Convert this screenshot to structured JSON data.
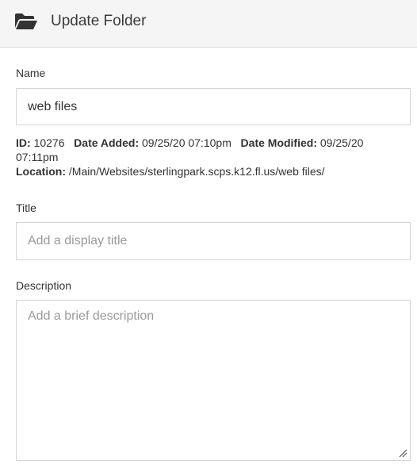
{
  "header": {
    "icon": "folder-open-icon",
    "title": "Update Folder"
  },
  "form": {
    "name": {
      "label": "Name",
      "value": "web files"
    },
    "meta": {
      "id_label": "ID:",
      "id_value": "10276",
      "date_added_label": "Date Added:",
      "date_added_value": "09/25/20 07:10pm",
      "date_modified_label": "Date Modified:",
      "date_modified_value": "09/25/20 07:11pm",
      "location_label": "Location:",
      "location_value": "/Main/Websites/sterlingpark.scps.k12.fl.us/web files/"
    },
    "title": {
      "label": "Title",
      "placeholder": "Add a display title"
    },
    "description": {
      "label": "Description",
      "placeholder": "Add a brief description"
    }
  }
}
